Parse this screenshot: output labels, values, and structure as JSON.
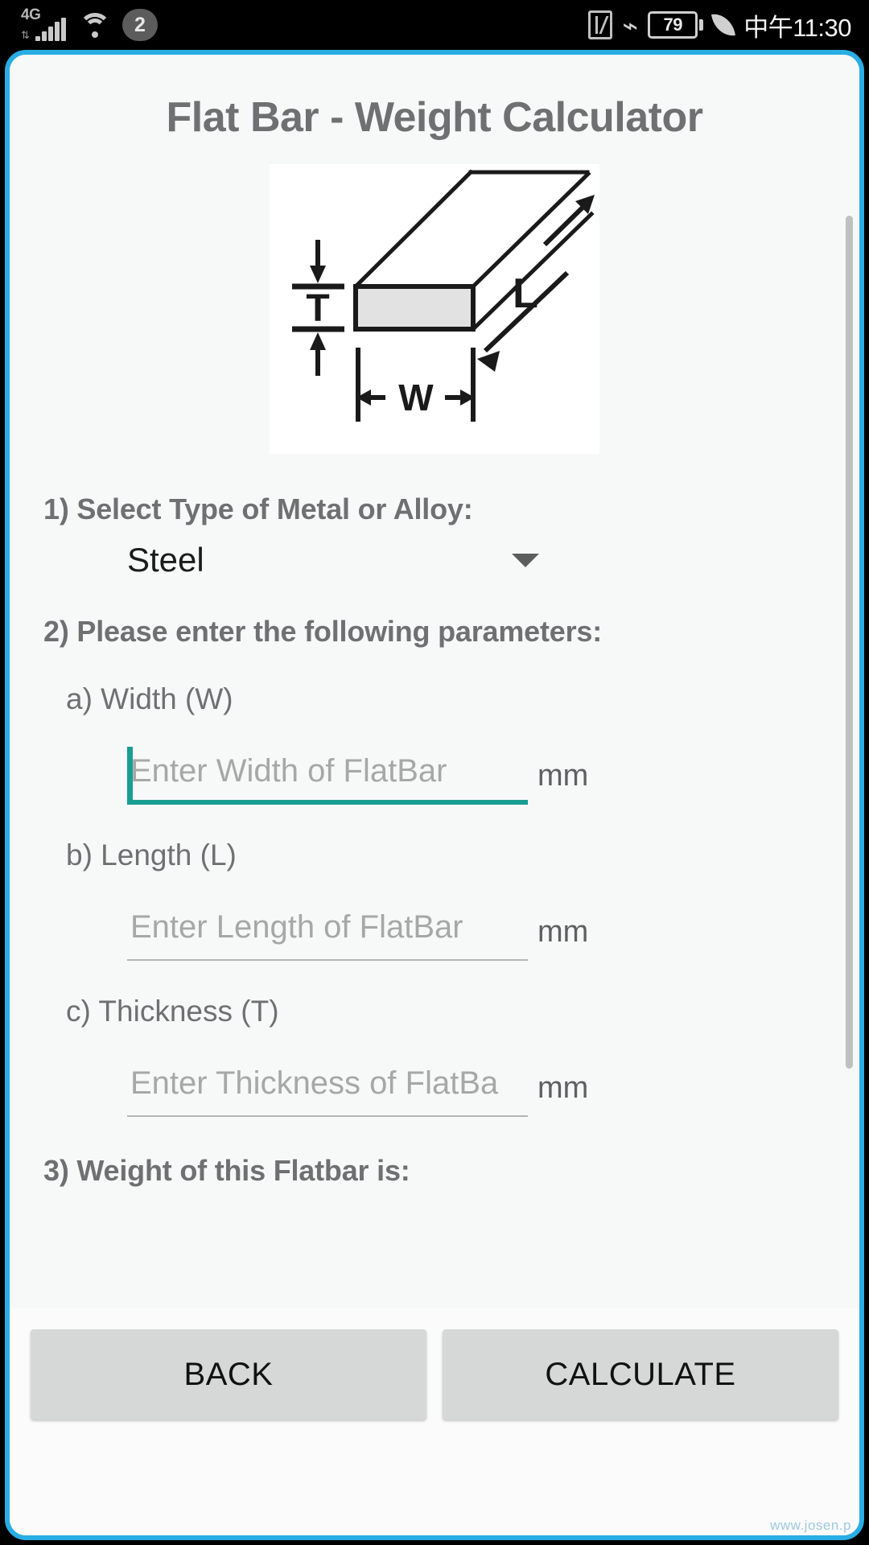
{
  "status_bar": {
    "network_type": "4G",
    "notification_count": "2",
    "battery_level": "79",
    "time": "中午11:30",
    "icons": [
      "signal-bars-icon",
      "wifi-icon",
      "nfc-icon",
      "bluetooth-icon",
      "battery-icon",
      "leaf-power-saving-icon"
    ]
  },
  "app": {
    "title": "Flat Bar - Weight Calculator",
    "diagram": {
      "name": "flat-bar-dimension-diagram",
      "labels": {
        "thickness": "T",
        "width": "W",
        "length": "L"
      }
    },
    "section1": {
      "heading": "1) Select Type of Metal or Alloy:",
      "selected_metal": "Steel"
    },
    "section2": {
      "heading": "2) Please enter the following parameters:",
      "fields": [
        {
          "label": "a) Width (W)",
          "placeholder": "Enter Width of FlatBar",
          "value": "",
          "unit": "mm",
          "focused": true
        },
        {
          "label": "b) Length (L)",
          "placeholder": "Enter Length of FlatBar",
          "value": "",
          "unit": "mm",
          "focused": false
        },
        {
          "label": "c) Thickness (T)",
          "placeholder": "Enter Thickness of FlatBa",
          "value": "",
          "unit": "mm",
          "focused": false
        }
      ]
    },
    "section3": {
      "heading": "3) Weight of this Flatbar is:",
      "result": ""
    },
    "buttons": {
      "back": "BACK",
      "calculate": "CALCULATE"
    },
    "watermark": "www.josen.p",
    "colors": {
      "frame_border": "#29ade4",
      "accent_focus": "#199e91",
      "heading_text": "#6f7072",
      "button_bg": "#d6d7d7",
      "page_bg": "#f7f8f8"
    }
  }
}
